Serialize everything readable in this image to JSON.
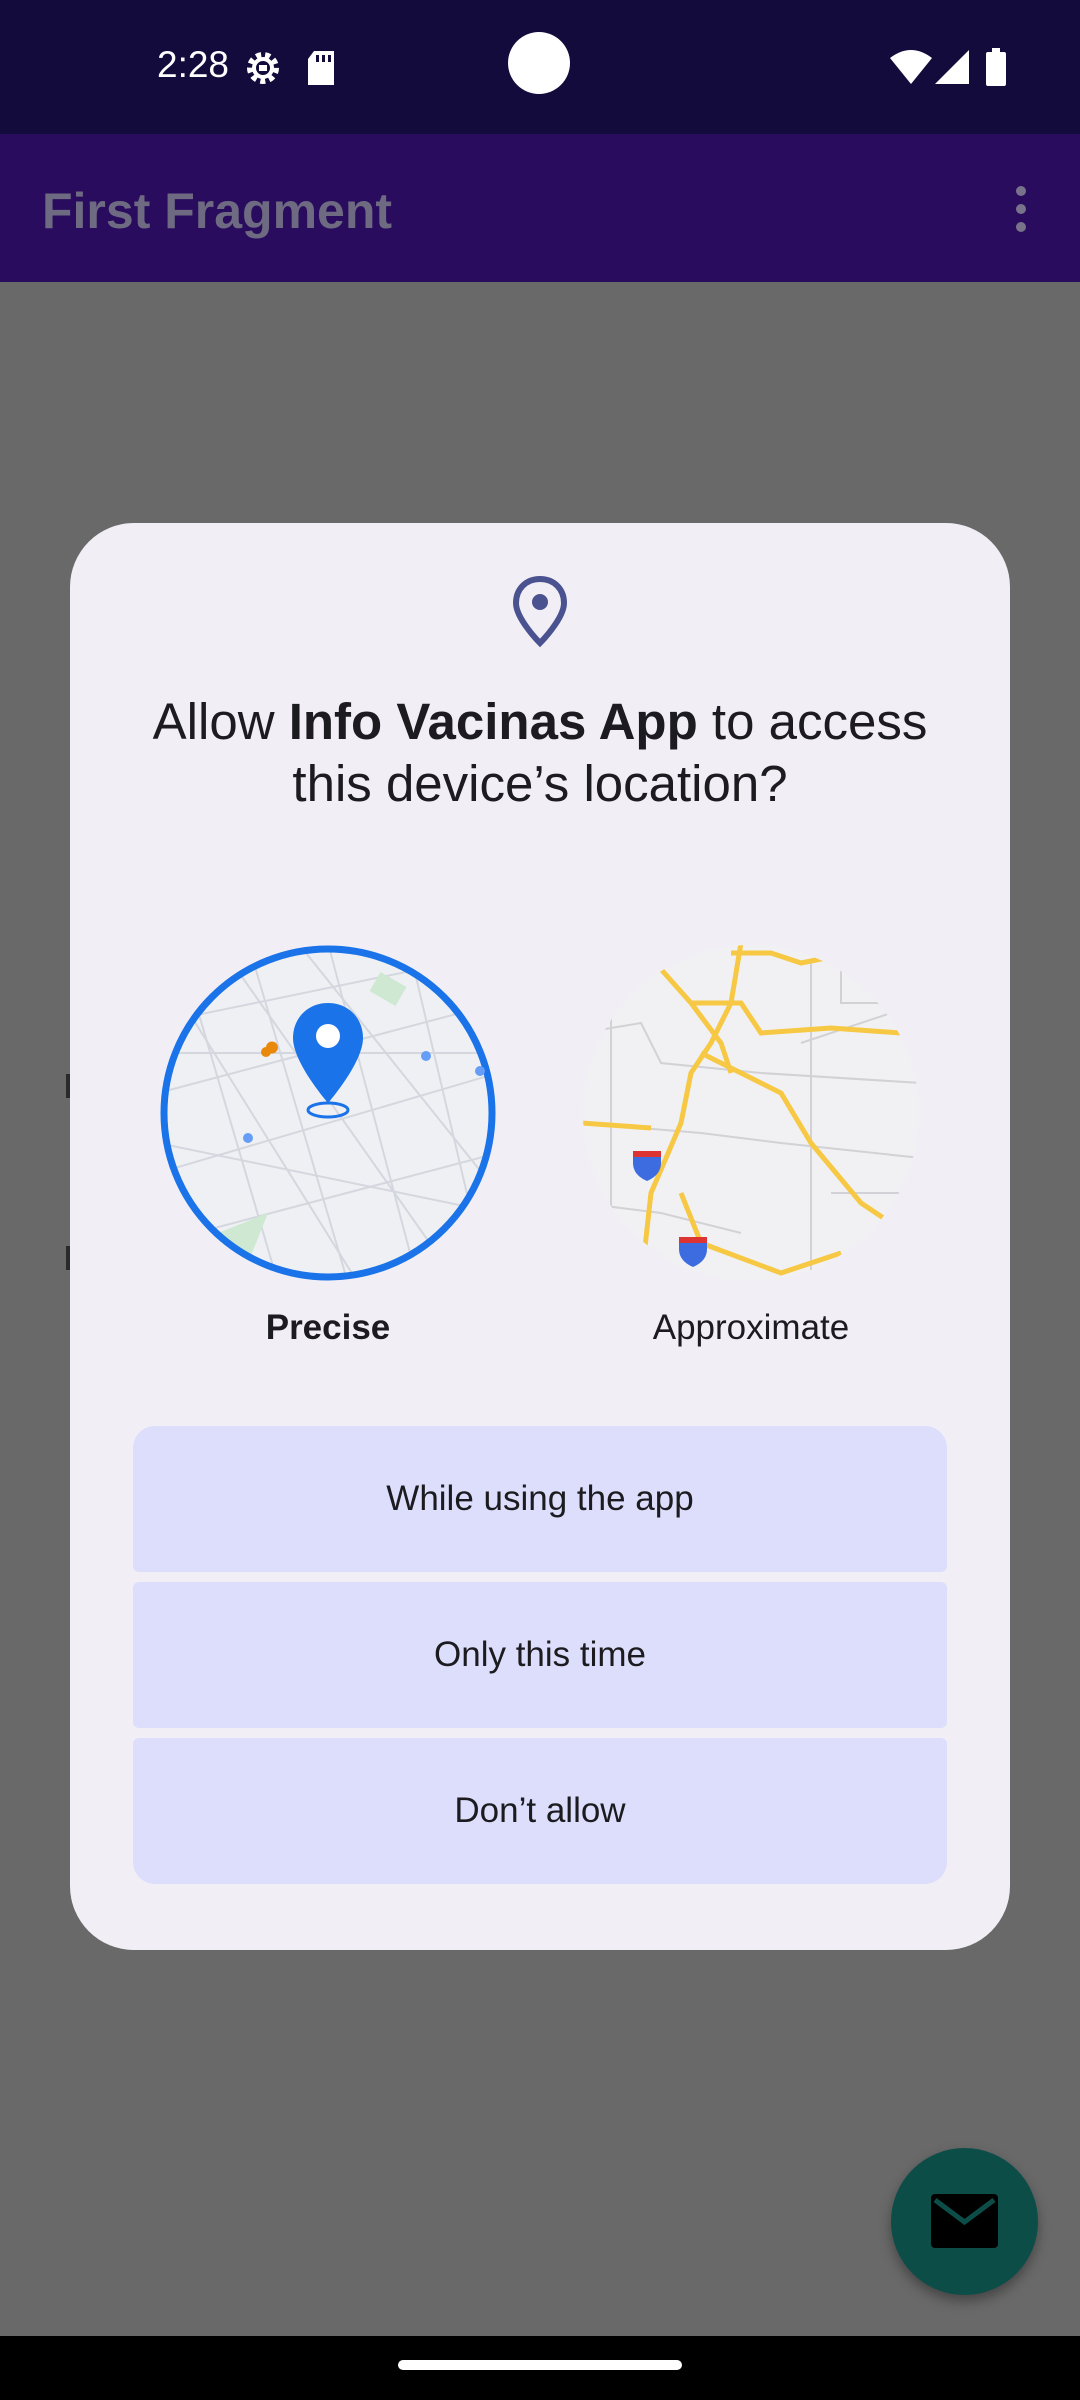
{
  "status_bar": {
    "time": "2:28",
    "icons": [
      "settings-gear-icon",
      "sd-card-icon",
      "wifi-icon",
      "cell-signal-icon",
      "battery-icon"
    ]
  },
  "app_bar": {
    "title": "First Fragment",
    "menu_icon": "overflow-menu-icon"
  },
  "dialog": {
    "icon": "location-pin-icon",
    "title_prefix": "Allow ",
    "app_name": "Info Vacinas App",
    "title_suffix": " to access this device’s location?",
    "options": {
      "precise_label": "Precise",
      "approximate_label": "Approximate",
      "selected": "Precise"
    },
    "buttons": {
      "while_using": "While using the app",
      "only_this_time": "Only this time",
      "dont_allow": "Don’t allow"
    }
  },
  "fab": {
    "icon": "email-icon"
  },
  "colors": {
    "status_bar": "#130b3b",
    "app_bar": "#2a0c5e",
    "scrim_background": "#696969",
    "dialog": "#f1eff5",
    "button": "#dcdefc",
    "precise_accent": "#1a73e8",
    "fab": "#0d4d48"
  }
}
